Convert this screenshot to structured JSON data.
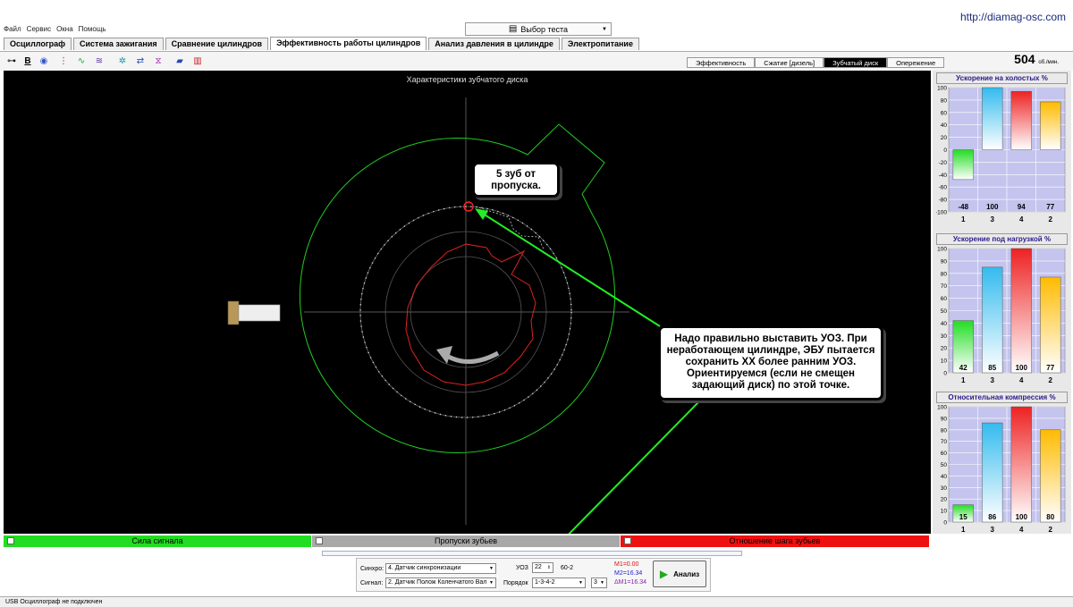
{
  "site_url": "http://diamag-osc.com",
  "menu": [
    "Файл",
    "Сервис",
    "Окна",
    "Помощь"
  ],
  "test_select": "Выбор теста",
  "tabs": [
    "Осциллограф",
    "Система зажигания",
    "Сравнение цилиндров",
    "Эффективность работы цилиндров",
    "Анализ давления в цилиндре",
    "Электропитание"
  ],
  "active_tab": 3,
  "subtabs": [
    "Эффективность",
    "Сжатие [дизель]",
    "Зубчатый диск",
    "Опережение"
  ],
  "active_subtab": 2,
  "rpm": {
    "value": "504",
    "unit": "об./мин."
  },
  "scope": {
    "title": "Характеристики зубчатого диска",
    "callout_1": "5 зуб от пропуска.",
    "callout_2": "Надо правильно выставить УОЗ. При неработающем цилиндре, ЭБУ пытается сохранить ХХ более ранним УОЗ. Ориентируемся (если не смещен задающий диск) по этой точке."
  },
  "legend": [
    {
      "label": "Сила сигнала",
      "color": "#22dd22"
    },
    {
      "label": "Пропуски зубьев",
      "color": "#a8a8a8"
    },
    {
      "label": "Отношение шага зубьев",
      "color": "#ee1111"
    }
  ],
  "controls": {
    "sync_label": "Синхро:",
    "sync_value": "4.  Датчик синхронизации",
    "signal_label": "Сигнал:",
    "signal_value": "2.  Датчик Полож Коленчатого Вал",
    "uoz_label": "УОЗ",
    "uoz_value": "22",
    "wheel": "60-2",
    "order_label": "Порядок",
    "order_value": "1-3-4-2",
    "cyl_value": "3",
    "m1": "M1=0.00",
    "m2": "M2=16.34",
    "dm": "ΔM1=16.34",
    "analyze": "Анализ"
  },
  "status": "USB Осциллограф не подключен",
  "chart_data": [
    {
      "type": "bar",
      "title": "Ускорение на холостых %",
      "categories": [
        "1",
        "3",
        "4",
        "2"
      ],
      "values": [
        -48,
        100,
        94,
        77
      ],
      "ylim": [
        -100,
        100
      ],
      "yticks": [
        100,
        80,
        60,
        40,
        20,
        0,
        -20,
        -40,
        -60,
        -80,
        -100
      ],
      "grid": true
    },
    {
      "type": "bar",
      "title": "Ускорение под нагрузкой %",
      "categories": [
        "1",
        "3",
        "4",
        "2"
      ],
      "values": [
        42,
        85,
        100,
        77
      ],
      "ylim": [
        0,
        100
      ],
      "yticks": [
        100,
        90,
        80,
        70,
        60,
        50,
        40,
        30,
        20,
        10,
        0
      ],
      "grid": true
    },
    {
      "type": "bar",
      "title": "Относительная компрессия %",
      "categories": [
        "1",
        "3",
        "4",
        "2"
      ],
      "values": [
        15,
        86,
        100,
        80
      ],
      "ylim": [
        0,
        100
      ],
      "yticks": [
        100,
        90,
        80,
        70,
        60,
        50,
        40,
        30,
        20,
        10,
        0
      ],
      "grid": true
    }
  ],
  "bar_colors": [
    "#22dd22",
    "#33bbee",
    "#ee2222",
    "#ffbb00"
  ]
}
